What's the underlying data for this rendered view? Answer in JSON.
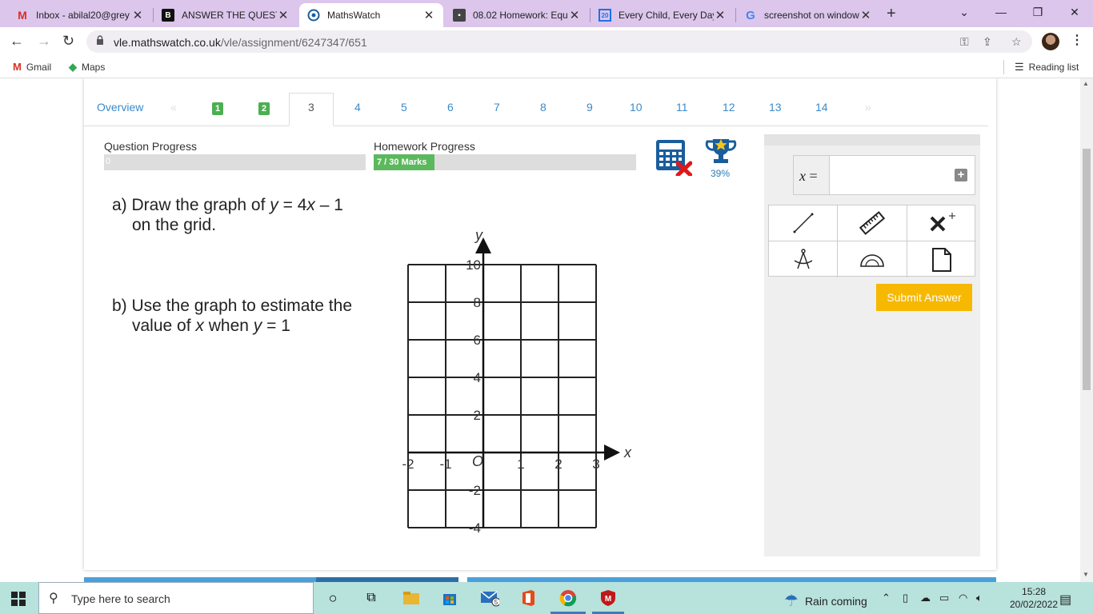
{
  "browser": {
    "tabs": [
      {
        "title": "Inbox - abilal20@grey",
        "favicon": "gmail-icon",
        "color": "#d93025"
      },
      {
        "title": "ANSWER THE QUESTIO",
        "favicon": "brainly-icon",
        "color": "#111111"
      },
      {
        "title": "MathsWatch",
        "favicon": "mathswatch-icon",
        "color": "#1a5d9c"
      },
      {
        "title": "08.02 Homework: Equ",
        "favicon": "homework-icon",
        "color": "#333333"
      },
      {
        "title": "Every Child, Every Day",
        "favicon": "calendar-icon",
        "color": "#1a73e8"
      },
      {
        "title": "screenshot on window",
        "favicon": "google-icon",
        "color": "#4285f4"
      }
    ],
    "url_host": "vle.mathswatch.co.uk",
    "url_path": "/vle/assignment/6247347/651",
    "bookmarks": [
      {
        "label": "Gmail"
      },
      {
        "label": "Maps"
      }
    ],
    "reading_list": "Reading list"
  },
  "question_nav": {
    "overview": "Overview",
    "prev": "«",
    "next": "»",
    "done": [
      "1",
      "2"
    ],
    "active": "3",
    "items": [
      "4",
      "5",
      "6",
      "7",
      "8",
      "9",
      "10",
      "11",
      "12",
      "13",
      "14"
    ]
  },
  "progress": {
    "question_label": "Question Progress",
    "question_value": "0",
    "question_fraction": 0.0,
    "homework_label": "Homework Progress",
    "homework_value": "7 / 30 Marks",
    "homework_fraction": 0.233,
    "trophy_percent": "39%"
  },
  "question": {
    "part_a_prefix": "a) Draw the graph of",
    "part_a_y": "y",
    "part_a_eq": "= 4",
    "part_a_x": "x",
    "part_a_rest": "– 1",
    "part_a_line2": "on the grid.",
    "part_b_line1": "b) Use the graph to estimate the",
    "part_b_l2_a": "value of",
    "part_b_x": "x",
    "part_b_l2_b": "when",
    "part_b_y": "y",
    "part_b_l2_c": "= 1"
  },
  "graph": {
    "x_axis_label": "x",
    "y_axis_label": "y",
    "origin_label": "O",
    "x_ticks": [
      "-2",
      "-1",
      "1",
      "2",
      "3"
    ],
    "y_ticks": [
      "10",
      "8",
      "6",
      "4",
      "2",
      "-2",
      "-4"
    ],
    "x_range": [
      -2,
      3
    ],
    "y_range": [
      -4,
      10
    ]
  },
  "answer": {
    "label_var": "x",
    "label_eq": "=",
    "value": "",
    "submit": "Submit Answer"
  },
  "colors": {
    "accent": "#3a8ac9",
    "done_badge": "#4caf50",
    "submit": "#f6b800"
  },
  "taskbar": {
    "search_placeholder": "Type here to search",
    "mail_badge": "5",
    "weather": "Rain coming",
    "time": "15:28",
    "date": "20/02/2022"
  }
}
